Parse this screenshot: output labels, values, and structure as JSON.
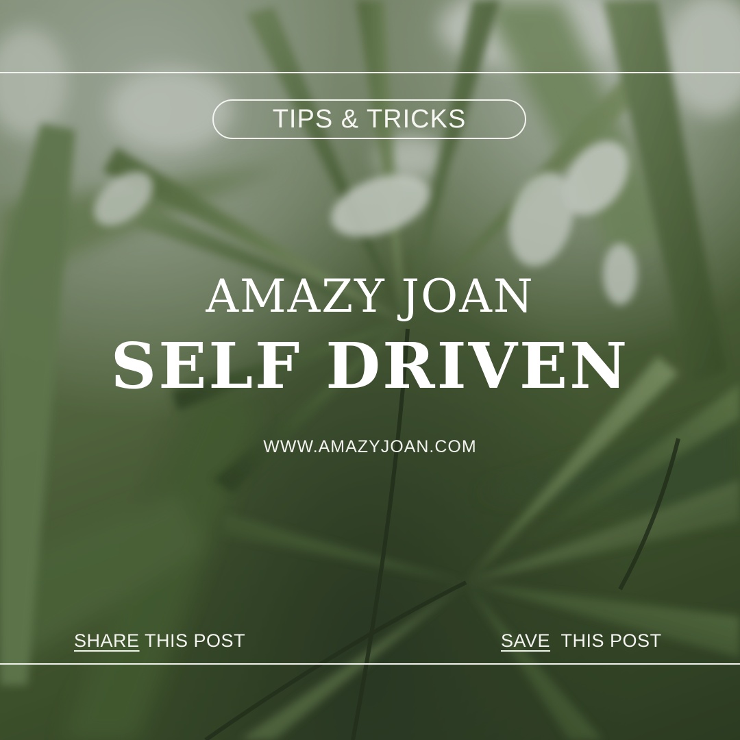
{
  "tag_label": "TIPS & TRICKS",
  "brand_name": "AMAZY JOAN",
  "headline": "SELF DRIVEN",
  "website": "WWW.AMAZYJOAN.COM",
  "share": {
    "link_label": "SHARE",
    "rest_label": " THIS POST"
  },
  "save": {
    "link_label": "SAVE",
    "rest_label": "  THIS POST"
  },
  "colors": {
    "text": "#ffffff",
    "rules": "#f2f2ee",
    "foliage_dark": "#2f4023",
    "foliage_mid": "#5f7448",
    "foliage_light": "#9aab82"
  }
}
